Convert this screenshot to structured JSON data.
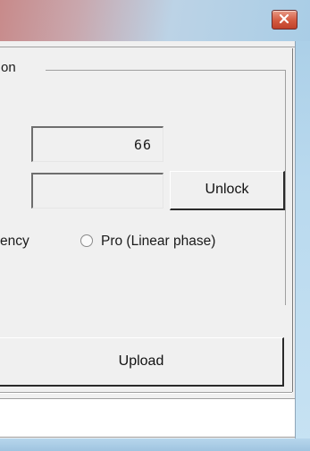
{
  "window": {
    "close_icon": "close-x-icon",
    "accent_red": "#c9462f",
    "frame_blue": "#a9cde6"
  },
  "group": {
    "label_fragment": "on"
  },
  "fields": {
    "code_value": "66",
    "key_value": ""
  },
  "buttons": {
    "unlock_label": "Unlock",
    "upload_label": "Upload"
  },
  "radios": [
    {
      "label": "ency",
      "selected": false
    },
    {
      "label": "Pro (Linear phase)",
      "selected": false
    }
  ],
  "status": {
    "text": ""
  }
}
